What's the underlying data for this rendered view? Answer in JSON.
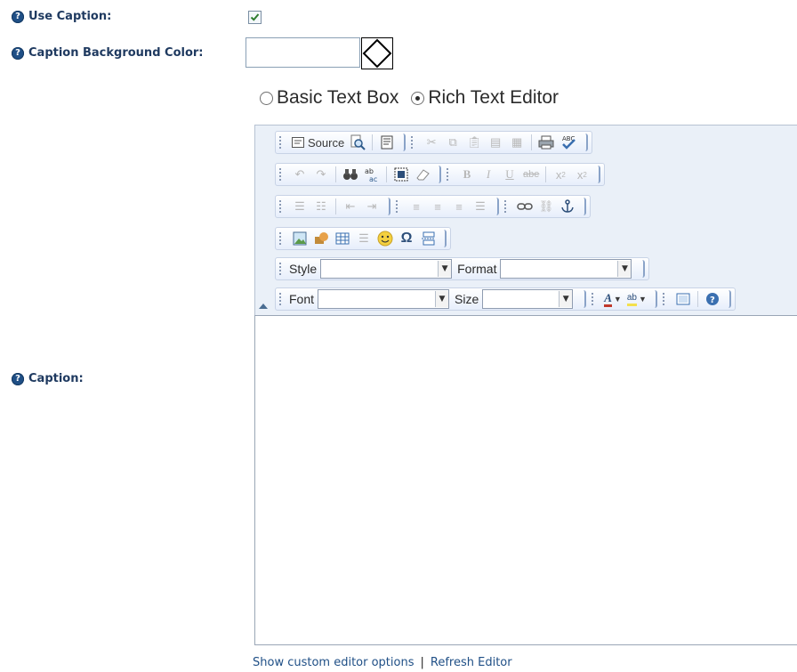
{
  "fields": {
    "use_caption": {
      "label": "Use Caption:",
      "checked": true
    },
    "caption_bg_color": {
      "label": "Caption Background Color:",
      "value": ""
    },
    "caption": {
      "label": "Caption:"
    }
  },
  "mode": {
    "options": [
      {
        "label": "Basic Text Box",
        "selected": false
      },
      {
        "label": "Rich Text Editor",
        "selected": true
      }
    ]
  },
  "toolbar": {
    "source_label": "Source",
    "style_label": "Style",
    "format_label": "Format",
    "font_label": "Font",
    "size_label": "Size",
    "style_value": "",
    "format_value": "",
    "font_value": "",
    "size_value": ""
  },
  "editor": {
    "content": ""
  },
  "footer": {
    "show_custom": "Show custom editor options",
    "refresh": "Refresh Editor",
    "divider": "|"
  },
  "colors": {
    "label": "#1f3a60",
    "help_icon": "#1f4f86",
    "link": "#1f4f86",
    "toolbar_bg": "#eaf0f8"
  }
}
